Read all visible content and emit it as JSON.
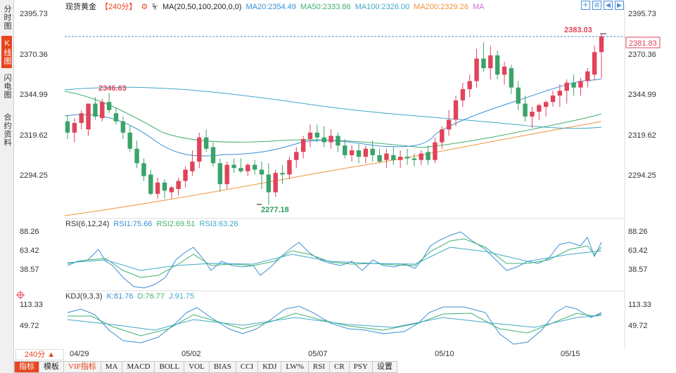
{
  "sidebar": {
    "tabs": [
      {
        "label": "分时图",
        "active": false
      },
      {
        "label": "K线图",
        "active": true
      },
      {
        "label": "闪电图",
        "active": false
      },
      {
        "label": "合约资料",
        "active": false
      }
    ]
  },
  "header": {
    "symbol": "现货黄金",
    "period": "【240分】",
    "ma_params": "MA(20,50,100,200,0,0)",
    "ma20": "MA20:2354.49",
    "ma50": "MA50:2333.86",
    "ma100": "MA100:2326.00",
    "ma200": "MA200:2329.26",
    "ma_extra": "MA"
  },
  "price_axis": [
    "2395.73",
    "2370.36",
    "2344.99",
    "2319.62",
    "2294.25"
  ],
  "current_price": "2381.83",
  "annotations": {
    "high": "2383.03",
    "mid_high": "2346.63",
    "low": "2277.18"
  },
  "rsi": {
    "title": "RSI(6,12,24)",
    "rsi1": "RSI1:75.66",
    "rsi2": "RSI2:69.51",
    "rsi3": "RSI3:63.26",
    "axis": [
      "88.26",
      "63.42",
      "38.57"
    ]
  },
  "kdj": {
    "title": "KDJ(9,3,3)",
    "k": "K:81.76",
    "d": "D:76.77",
    "j": "J:91.75",
    "axis": [
      "113.33",
      "49.72"
    ]
  },
  "period_button": "240分 ▲",
  "dates": [
    "04/29",
    "05/02",
    "05/07",
    "05/10",
    "05/15"
  ],
  "bottom_tabs": [
    "指标",
    "模板",
    "VIP指标",
    "MA",
    "MACD",
    "BOLL",
    "VOL",
    "BIAS",
    "CCI",
    "KDJ",
    "LW%",
    "RSI",
    "CR",
    "PSY",
    "设置"
  ],
  "colors": {
    "up": "#e0435a",
    "down": "#3aa36a",
    "accent": "#e8451e",
    "ma20": "#3a8fd6",
    "ma50": "#40b070",
    "ma100": "#41a8c8",
    "ma200": "#f0943a"
  },
  "chart_data": {
    "type": "candlestick",
    "ylim": [
      2270,
      2400
    ],
    "ohlc": [
      [
        2329,
        2333,
        2318,
        2322
      ],
      [
        2322,
        2331,
        2316,
        2328
      ],
      [
        2328,
        2336,
        2324,
        2334
      ],
      [
        2324,
        2340,
        2320,
        2340
      ],
      [
        2340,
        2344,
        2330,
        2332
      ],
      [
        2331,
        2343,
        2329,
        2341
      ],
      [
        2341,
        2346.63,
        2334,
        2336
      ],
      [
        2334,
        2337,
        2327,
        2329
      ],
      [
        2329,
        2332,
        2318,
        2322
      ],
      [
        2322,
        2326,
        2310,
        2312
      ],
      [
        2312,
        2317,
        2300,
        2303
      ],
      [
        2303,
        2306,
        2292,
        2295
      ],
      [
        2296,
        2299,
        2283,
        2284
      ],
      [
        2284,
        2294,
        2281,
        2291
      ],
      [
        2291,
        2293,
        2281,
        2286
      ],
      [
        2285,
        2289,
        2281,
        2288
      ],
      [
        2287,
        2294,
        2283,
        2292
      ],
      [
        2292,
        2301,
        2288,
        2299
      ],
      [
        2298,
        2311,
        2295,
        2304
      ],
      [
        2304,
        2322,
        2300,
        2319
      ],
      [
        2319,
        2324,
        2310,
        2312
      ],
      [
        2313,
        2316,
        2301,
        2303
      ],
      [
        2303,
        2306,
        2285,
        2290
      ],
      [
        2290,
        2304,
        2287,
        2302
      ],
      [
        2302,
        2306,
        2297,
        2300
      ],
      [
        2300,
        2306,
        2297,
        2298
      ],
      [
        2298,
        2303,
        2295,
        2302
      ],
      [
        2302,
        2305,
        2296,
        2299
      ],
      [
        2299,
        2304,
        2287,
        2296
      ],
      [
        2296,
        2303,
        2277.18,
        2285
      ],
      [
        2285,
        2299,
        2282,
        2297
      ],
      [
        2297,
        2302,
        2290,
        2296
      ],
      [
        2296,
        2307,
        2293,
        2305
      ],
      [
        2305,
        2313,
        2300,
        2310
      ],
      [
        2310,
        2320,
        2306,
        2318
      ],
      [
        2318,
        2327,
        2313,
        2322
      ],
      [
        2322,
        2327,
        2316,
        2319
      ],
      [
        2319,
        2326,
        2313,
        2316
      ],
      [
        2316,
        2324,
        2312,
        2320
      ],
      [
        2320,
        2322,
        2310,
        2314
      ],
      [
        2314,
        2318,
        2306,
        2308
      ],
      [
        2308,
        2314,
        2304,
        2311
      ],
      [
        2311,
        2315,
        2303,
        2307
      ],
      [
        2307,
        2314,
        2303,
        2312
      ],
      [
        2312,
        2317,
        2304,
        2308
      ],
      [
        2308,
        2312,
        2303,
        2304
      ],
      [
        2305,
        2312,
        2300,
        2309
      ],
      [
        2308,
        2313,
        2302,
        2305
      ],
      [
        2305,
        2311,
        2300,
        2307
      ],
      [
        2307,
        2312,
        2302,
        2306
      ],
      [
        2306,
        2309,
        2301,
        2305
      ],
      [
        2305,
        2311,
        2302,
        2309
      ],
      [
        2310,
        2314,
        2302,
        2305
      ],
      [
        2305,
        2319,
        2303,
        2316
      ],
      [
        2316,
        2326,
        2312,
        2324
      ],
      [
        2324,
        2336,
        2320,
        2330
      ],
      [
        2330,
        2345,
        2326,
        2342
      ],
      [
        2342,
        2353,
        2338,
        2349
      ],
      [
        2349,
        2358,
        2344,
        2354
      ],
      [
        2354,
        2374,
        2350,
        2368
      ],
      [
        2368,
        2378,
        2360,
        2362
      ],
      [
        2362,
        2376,
        2355,
        2370
      ],
      [
        2370,
        2373,
        2355,
        2358
      ],
      [
        2358,
        2366,
        2352,
        2363
      ],
      [
        2362,
        2364,
        2346,
        2350
      ],
      [
        2350,
        2354,
        2336,
        2340
      ],
      [
        2340,
        2345,
        2329,
        2332
      ],
      [
        2332,
        2338,
        2325,
        2335
      ],
      [
        2335,
        2340,
        2330,
        2339
      ],
      [
        2338,
        2342,
        2332,
        2341
      ],
      [
        2341,
        2348,
        2338,
        2345
      ],
      [
        2345,
        2352,
        2338,
        2348
      ],
      [
        2348,
        2355,
        2340,
        2353
      ],
      [
        2353,
        2358,
        2345,
        2350
      ],
      [
        2350,
        2356,
        2345,
        2354
      ],
      [
        2354,
        2362,
        2350,
        2360
      ],
      [
        2358,
        2376,
        2355,
        2372
      ],
      [
        2372,
        2383.03,
        2356,
        2381.83
      ]
    ]
  }
}
